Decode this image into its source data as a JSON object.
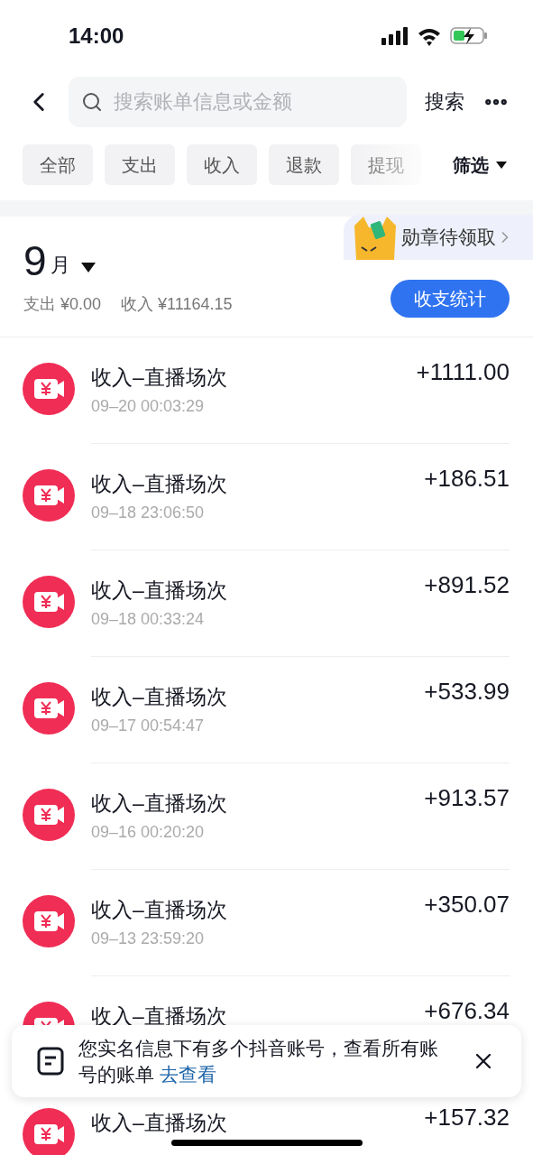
{
  "status_bar": {
    "time": "14:00"
  },
  "search": {
    "placeholder": "搜索账单信息或金额",
    "button": "搜索"
  },
  "tabs": [
    {
      "label": "全部",
      "selected": false
    },
    {
      "label": "支出",
      "selected": false
    },
    {
      "label": "收入",
      "selected": false
    },
    {
      "label": "退款",
      "selected": false
    },
    {
      "label": "提现",
      "selected": false
    }
  ],
  "filter": "筛选",
  "badge_promo": "勋章待领取",
  "month": {
    "number": "9",
    "unit": "月",
    "expense": "支出 ¥0.00",
    "income": "收入 ¥11164.15",
    "stats_button": "收支统计"
  },
  "transactions": [
    {
      "title": "收入–直播场次",
      "time": "09–20 00:03:29",
      "amount": "+1111.00"
    },
    {
      "title": "收入–直播场次",
      "time": "09–18 23:06:50",
      "amount": "+186.51"
    },
    {
      "title": "收入–直播场次",
      "time": "09–18 00:33:24",
      "amount": "+891.52"
    },
    {
      "title": "收入–直播场次",
      "time": "09–17 00:54:47",
      "amount": "+533.99"
    },
    {
      "title": "收入–直播场次",
      "time": "09–16 00:20:20",
      "amount": "+913.57"
    },
    {
      "title": "收入–直播场次",
      "time": "09–13 23:59:20",
      "amount": "+350.07"
    },
    {
      "title": "收入–直播场次",
      "amount": "+676.34"
    },
    {
      "title": "收入–直播场次",
      "amount": "+157.32"
    }
  ],
  "notice": {
    "text": "您实名信息下有多个抖音账号，查看所有账号的账单",
    "link": "去查看"
  }
}
